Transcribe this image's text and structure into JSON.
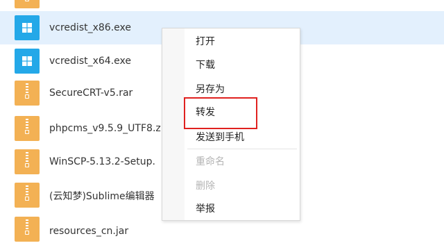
{
  "files": [
    {
      "name": "",
      "type": "rar"
    },
    {
      "name": "vcredist_x86.exe",
      "type": "exe",
      "selected": true
    },
    {
      "name": "vcredist_x64.exe",
      "type": "exe"
    },
    {
      "name": "SecureCRT-v5.rar",
      "type": "rar"
    },
    {
      "name": "phpcms_v9.5.9_UTF8.z",
      "type": "rar"
    },
    {
      "name": "WinSCP-5.13.2-Setup.",
      "type": "rar"
    },
    {
      "name": "(云知梦)Sublime编辑器",
      "type": "rar"
    },
    {
      "name": "resources_cn.jar",
      "type": "rar"
    }
  ],
  "context_menu": {
    "items": [
      {
        "label": "打开",
        "enabled": true
      },
      {
        "label": "下载",
        "enabled": true
      },
      {
        "label": "另存为",
        "enabled": true
      },
      {
        "label": "转发",
        "enabled": true,
        "highlighted": true
      },
      {
        "label": "发送到手机",
        "enabled": true
      },
      {
        "label": "重命名",
        "enabled": false
      },
      {
        "label": "删除",
        "enabled": false
      },
      {
        "label": "举报",
        "enabled": true
      }
    ]
  },
  "colors": {
    "selected_row": "#e3f0fd",
    "exe_icon": "#24a8e8",
    "archive_icon": "#f3b154",
    "highlight_border": "#e0211f",
    "disabled_text": "#b4b4b4"
  },
  "icons": {
    "exe": "windows-logo-icon",
    "rar": "zip-archive-icon"
  }
}
